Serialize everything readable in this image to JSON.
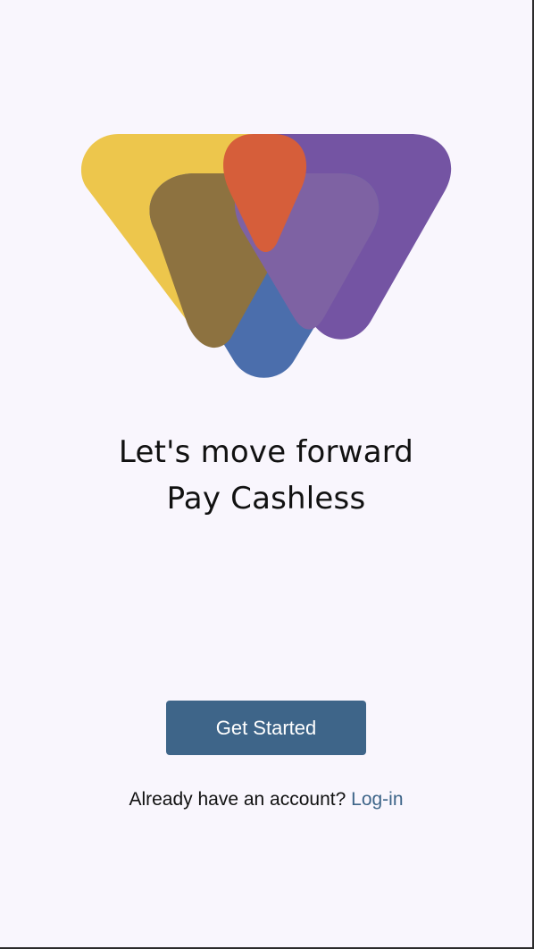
{
  "hero": {
    "logo_icon": "brand-triangles-logo",
    "colors": {
      "yellow": "#edc64c",
      "purple": "#7454a3",
      "blue": "#4b6eac",
      "brown": "#8d7240",
      "orange": "#d65e3a",
      "violet": "#7e62a3"
    }
  },
  "headline": {
    "line1": "Let's move forward",
    "line2": "Pay Cashless"
  },
  "actions": {
    "get_started_label": "Get Started",
    "account_prompt": "Already have an account?",
    "login_label": "Log-in"
  },
  "theme": {
    "background": "#f9f6fd",
    "button": "#3e6589",
    "text": "#111111"
  }
}
